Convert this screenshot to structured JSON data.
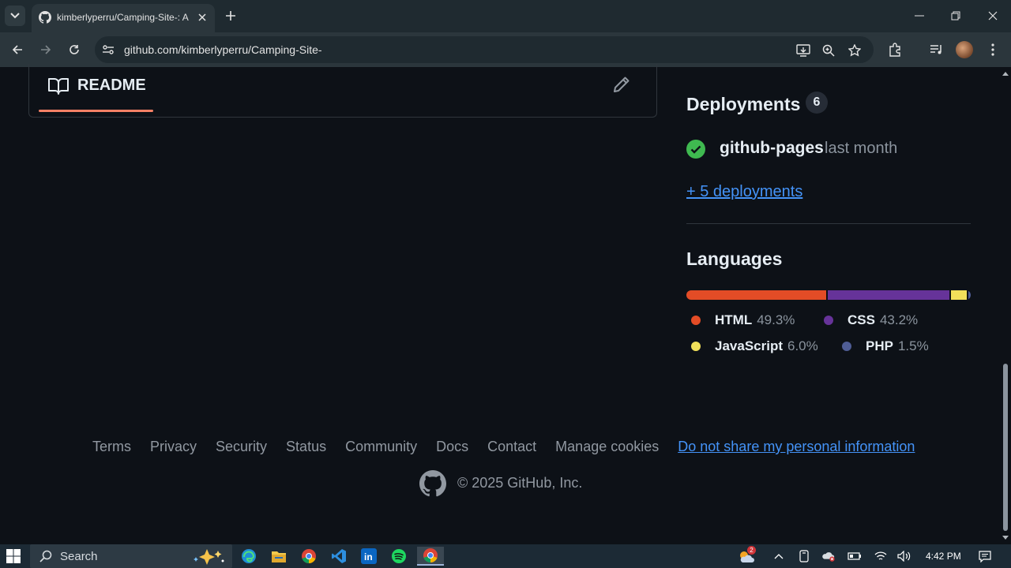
{
  "browser": {
    "tab_title": "kimberlyperru/Camping-Site-: A",
    "url": "github.com/kimberlyperru/Camping-Site-"
  },
  "readme": {
    "title": "README"
  },
  "deployments": {
    "title": "Deployments",
    "count": "6",
    "environment": "github-pages",
    "time": "last month",
    "more_link": "+ 5 deployments"
  },
  "languages": {
    "title": "Languages",
    "items": [
      {
        "name": "HTML",
        "percent": "49.3%",
        "value": 49.3,
        "color": "#e34c26"
      },
      {
        "name": "CSS",
        "percent": "43.2%",
        "value": 43.2,
        "color": "#663399"
      },
      {
        "name": "JavaScript",
        "percent": "6.0%",
        "value": 6.0,
        "color": "#f1e05a"
      },
      {
        "name": "PHP",
        "percent": "1.5%",
        "value": 1.5,
        "color": "#4f5d95"
      }
    ]
  },
  "footer": {
    "links": [
      "Terms",
      "Privacy",
      "Security",
      "Status",
      "Community",
      "Docs",
      "Contact",
      "Manage cookies"
    ],
    "privacy_link": "Do not share my personal information",
    "copyright": "© 2025 GitHub, Inc."
  },
  "taskbar": {
    "search_placeholder": "Search",
    "time": "4:42 PM",
    "weather_badge": "2"
  }
}
